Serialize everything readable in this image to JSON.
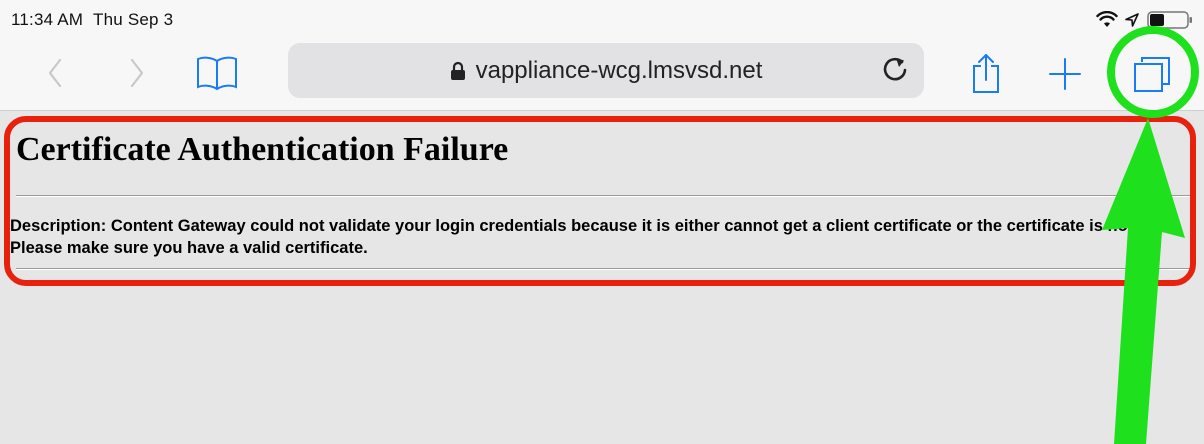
{
  "status_bar": {
    "time": "11:34 AM",
    "date": "Thu Sep 3",
    "icons": [
      "wifi-icon",
      "location-icon",
      "battery-icon"
    ]
  },
  "toolbar": {
    "back_icon": "chevron-left-icon",
    "forward_icon": "chevron-right-icon",
    "bookmarks_icon": "book-icon",
    "address": {
      "lock_icon": "lock-icon",
      "url": "vappliance-wcg.lmsvsd.net",
      "reload_icon": "reload-icon"
    },
    "share_icon": "share-icon",
    "new_tab_icon": "plus-icon",
    "tabs_icon": "tabs-overview-icon"
  },
  "page": {
    "title": "Certificate Authentication Failure",
    "description": "Description: Content Gateway could not validate your login credentials because it is either cannot get a client certificate or the certificate is not valid. Please make sure you have a valid certificate."
  },
  "colors": {
    "chrome_background": "#f7f7f7",
    "page_background": "#e6e6e6",
    "toolbar_icon": "#1a7cf5",
    "toolbar_icon_disabled": "#c8c8cc",
    "annotation_red": "#e8210f",
    "annotation_green": "#1fe01c"
  }
}
